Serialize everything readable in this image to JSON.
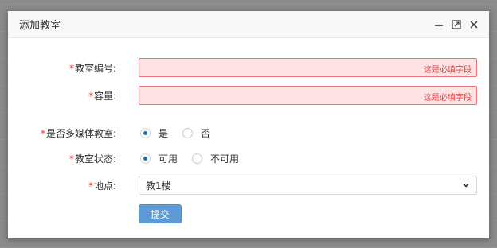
{
  "dialog": {
    "title": "添加教室",
    "controls": {
      "minimize_icon": "minimize-icon",
      "maximize_icon": "maximize-icon",
      "close_icon": "close-icon"
    }
  },
  "form": {
    "required_mark": "*",
    "room_number": {
      "label": "教室编号:",
      "value": "",
      "error": "这是必填字段"
    },
    "capacity": {
      "label": "容量:",
      "value": "",
      "error": "这是必填字段"
    },
    "multimedia": {
      "label": "是否多媒体教室:",
      "options": [
        {
          "label": "是",
          "checked": true
        },
        {
          "label": "否",
          "checked": false
        }
      ]
    },
    "status": {
      "label": "教室状态:",
      "options": [
        {
          "label": "可用",
          "checked": true
        },
        {
          "label": "不可用",
          "checked": false
        }
      ]
    },
    "location": {
      "label": "地点:",
      "selected": "教1楼"
    },
    "submit_label": "提交"
  },
  "colors": {
    "error_bg": "#fde3e3",
    "error_border": "#e8737a",
    "error_text": "#e03a3a",
    "radio_checked": "#1f6fa8",
    "submit_bg": "#5d9ad6"
  }
}
